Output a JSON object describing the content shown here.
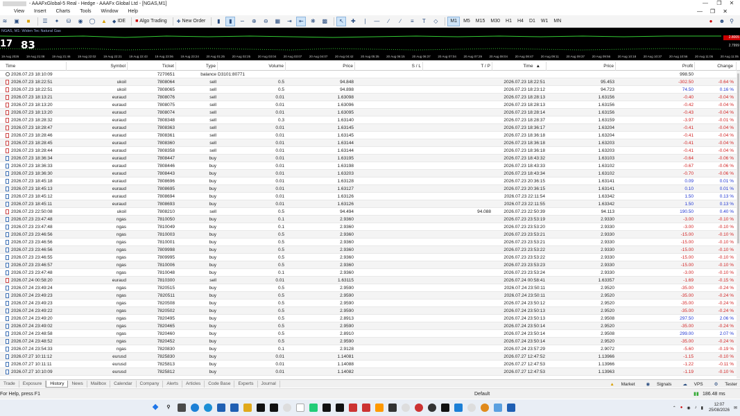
{
  "window": {
    "title": "- AAAFxGlobal-5 Real - Hedge - AAAFx Global Ltd - [NGAS,M1]"
  },
  "menu": [
    "File",
    "View",
    "Insert",
    "Charts",
    "Tools",
    "Window",
    "Help"
  ],
  "toolbar": {
    "ide_label": "IDE",
    "algo_label": "Algo Trading",
    "new_order_label": "New Order",
    "timeframes": [
      "M1",
      "M5",
      "M15",
      "M30",
      "H1",
      "H4",
      "D1",
      "W1",
      "MN"
    ],
    "active_timeframe": "M1"
  },
  "chart": {
    "symbol_line": "NGAS, M1: Widen Tec Natural Gas",
    "big_left": "17",
    "big_mid": "83",
    "price_top": "2.8005",
    "price_mid": "2.7999",
    "time_ticks": [
      "19 Aug 2026",
      "19 Aug 21:08",
      "19 Aug 21:46",
      "19 Aug 22:02",
      "19 Aug 22:21",
      "19 Aug 22:43",
      "19 Aug 23:06",
      "19 Aug 23:24",
      "20 Aug 01:25",
      "20 Aug 02:25",
      "20 Aug 03:04",
      "20 Aug 03:07",
      "20 Aug 04:07",
      "20 Aug 04:42",
      "20 Aug 05:35",
      "20 Aug 06:15",
      "20 Aug 06:37",
      "20 Aug 07:04",
      "20 Aug 07:29",
      "20 Aug 08:04",
      "20 Aug 08:47",
      "20 Aug 09:11",
      "20 Aug 09:37",
      "20 Aug 09:56",
      "20 Aug 10:18",
      "20 Aug 10:37",
      "20 Aug 10:56",
      "20 Aug 11:05",
      "20 Aug 11:05"
    ]
  },
  "table": {
    "headers": {
      "time": "Time",
      "symbol": "Symbol",
      "ticket": "Ticket",
      "type": "Type",
      "volume": "Volume",
      "price": "Price",
      "sl": "S / L",
      "tp": "T / P",
      "time2": "Time",
      "price2": "Price",
      "profit": "Profit",
      "change": "Change"
    },
    "rows": [
      {
        "k": "balance",
        "t": "2026.07.23 18:10:09",
        "s": "",
        "tk": "7270651",
        "ty": "balance",
        "v": "D3101:80771",
        "p": "",
        "sl": "",
        "tp": "",
        "t2": "",
        "p2": "",
        "pr": "998.50",
        "ch": ""
      },
      {
        "k": "sell",
        "t": "2026.07.23 18:22:51",
        "s": "ukoil",
        "tk": "7808064",
        "ty": "sell",
        "v": "0.5",
        "p": "94.848",
        "sl": "",
        "tp": "",
        "t2": "2026.07.23 18:22:51",
        "p2": "95.453",
        "pr": "-302.50",
        "ch": "-0.64 %"
      },
      {
        "k": "sell",
        "t": "2026.07.23 18:22:51",
        "s": "ukoil",
        "tk": "7808065",
        "ty": "sell",
        "v": "0.5",
        "p": "94.898",
        "sl": "",
        "tp": "",
        "t2": "2026.07.23 18:23:12",
        "p2": "94.723",
        "pr": "74.50",
        "ch": "0.16 %"
      },
      {
        "k": "sell",
        "t": "2026.07.23 18:13:21",
        "s": "euraud",
        "tk": "7808076",
        "ty": "sell",
        "v": "0.01",
        "p": "1.63098",
        "sl": "",
        "tp": "",
        "t2": "2026.07.23 18:28:13",
        "p2": "1.63156",
        "pr": "-0.40",
        "ch": "-0.04 %"
      },
      {
        "k": "sell",
        "t": "2026.07.23 18:13:20",
        "s": "euraud",
        "tk": "7808075",
        "ty": "sell",
        "v": "0.01",
        "p": "1.63096",
        "sl": "",
        "tp": "",
        "t2": "2026.07.23 18:28:13",
        "p2": "1.63156",
        "pr": "-0.42",
        "ch": "-0.04 %"
      },
      {
        "k": "sell",
        "t": "2026.07.23 18:13:20",
        "s": "euraud",
        "tk": "7808074",
        "ty": "sell",
        "v": "0.01",
        "p": "1.63095",
        "sl": "",
        "tp": "",
        "t2": "2026.07.23 18:28:14",
        "p2": "1.63156",
        "pr": "-0.43",
        "ch": "-0.04 %"
      },
      {
        "k": "sell",
        "t": "2026.07.23 18:28:32",
        "s": "euraud",
        "tk": "7808348",
        "ty": "sell",
        "v": "0.3",
        "p": "1.63140",
        "sl": "",
        "tp": "",
        "t2": "2026.07.23 18:28:37",
        "p2": "1.63159",
        "pr": "-3.97",
        "ch": "-0.01 %"
      },
      {
        "k": "sell",
        "t": "2026.07.23 18:28:47",
        "s": "euraud",
        "tk": "7808363",
        "ty": "sell",
        "v": "0.01",
        "p": "1.63145",
        "sl": "",
        "tp": "",
        "t2": "2026.07.23 18:36:17",
        "p2": "1.63204",
        "pr": "-0.41",
        "ch": "-0.04 %"
      },
      {
        "k": "sell",
        "t": "2026.07.23 18:28:46",
        "s": "euraud",
        "tk": "7808361",
        "ty": "sell",
        "v": "0.01",
        "p": "1.63145",
        "sl": "",
        "tp": "",
        "t2": "2026.07.23 18:36:18",
        "p2": "1.63204",
        "pr": "-0.41",
        "ch": "-0.04 %"
      },
      {
        "k": "sell",
        "t": "2026.07.23 18:28:45",
        "s": "euraud",
        "tk": "7808360",
        "ty": "sell",
        "v": "0.01",
        "p": "1.63144",
        "sl": "",
        "tp": "",
        "t2": "2026.07.23 18:36:18",
        "p2": "1.63203",
        "pr": "-0.41",
        "ch": "-0.04 %"
      },
      {
        "k": "sell",
        "t": "2026.07.23 18:28:44",
        "s": "euraud",
        "tk": "7808358",
        "ty": "sell",
        "v": "0.01",
        "p": "1.63144",
        "sl": "",
        "tp": "",
        "t2": "2026.07.23 18:36:18",
        "p2": "1.63203",
        "pr": "-0.41",
        "ch": "-0.04 %"
      },
      {
        "k": "buy",
        "t": "2026.07.23 18:36:34",
        "s": "euraud",
        "tk": "7808447",
        "ty": "buy",
        "v": "0.01",
        "p": "1.63195",
        "sl": "",
        "tp": "",
        "t2": "2026.07.23 18:43:32",
        "p2": "1.63103",
        "pr": "-0.64",
        "ch": "-0.06 %"
      },
      {
        "k": "buy",
        "t": "2026.07.23 18:36:33",
        "s": "euraud",
        "tk": "7808446",
        "ty": "buy",
        "v": "0.01",
        "p": "1.63198",
        "sl": "",
        "tp": "",
        "t2": "2026.07.23 18:43:33",
        "p2": "1.63102",
        "pr": "-0.67",
        "ch": "-0.06 %"
      },
      {
        "k": "buy",
        "t": "2026.07.23 18:36:30",
        "s": "euraud",
        "tk": "7808443",
        "ty": "buy",
        "v": "0.01",
        "p": "1.63203",
        "sl": "",
        "tp": "",
        "t2": "2026.07.23 18:43:34",
        "p2": "1.63102",
        "pr": "-0.70",
        "ch": "-0.06 %"
      },
      {
        "k": "buy",
        "t": "2026.07.23 18:45:18",
        "s": "euraud",
        "tk": "7808696",
        "ty": "buy",
        "v": "0.01",
        "p": "1.63128",
        "sl": "",
        "tp": "",
        "t2": "2026.07.23 20:36:15",
        "p2": "1.63141",
        "pr": "0.09",
        "ch": "0.01 %"
      },
      {
        "k": "buy",
        "t": "2026.07.23 18:45:13",
        "s": "euraud",
        "tk": "7808695",
        "ty": "buy",
        "v": "0.01",
        "p": "1.63127",
        "sl": "",
        "tp": "",
        "t2": "2026.07.23 20:36:15",
        "p2": "1.63141",
        "pr": "0.10",
        "ch": "0.01 %"
      },
      {
        "k": "buy",
        "t": "2026.07.23 18:45:12",
        "s": "euraud",
        "tk": "7808694",
        "ty": "buy",
        "v": "0.01",
        "p": "1.63126",
        "sl": "",
        "tp": "",
        "t2": "2026.07.23 22:11:54",
        "p2": "1.63342",
        "pr": "1.50",
        "ch": "0.13 %"
      },
      {
        "k": "buy",
        "t": "2026.07.23 18:45:11",
        "s": "euraud",
        "tk": "7808693",
        "ty": "buy",
        "v": "0.01",
        "p": "1.63126",
        "sl": "",
        "tp": "",
        "t2": "2026.07.23 22:11:55",
        "p2": "1.63342",
        "pr": "1.50",
        "ch": "0.13 %"
      },
      {
        "k": "sell",
        "t": "2026.07.23 22:50:08",
        "s": "ukoil",
        "tk": "7808210",
        "ty": "sell",
        "v": "0.5",
        "p": "94.494",
        "sl": "",
        "tp": "94.088",
        "t2": "2026.07.23 22:50:39",
        "p2": "94.113",
        "pr": "190.50",
        "ch": "0.40 %"
      },
      {
        "k": "buy",
        "t": "2026.07.23 23:47:48",
        "s": "ngas",
        "tk": "7810050",
        "ty": "buy",
        "v": "0.1",
        "p": "2.9360",
        "sl": "",
        "tp": "",
        "t2": "2026.07.23 23:53:19",
        "p2": "2.9330",
        "pr": "-3.00",
        "ch": "-0.10 %"
      },
      {
        "k": "buy",
        "t": "2026.07.23 23:47:48",
        "s": "ngas",
        "tk": "7810049",
        "ty": "buy",
        "v": "0.1",
        "p": "2.9360",
        "sl": "",
        "tp": "",
        "t2": "2026.07.23 23:53:20",
        "p2": "2.9330",
        "pr": "-3.00",
        "ch": "-0.10 %"
      },
      {
        "k": "buy",
        "t": "2026.07.23 23:46:56",
        "s": "ngas",
        "tk": "7810003",
        "ty": "buy",
        "v": "0.5",
        "p": "2.9360",
        "sl": "",
        "tp": "",
        "t2": "2026.07.23 23:53:21",
        "p2": "2.9330",
        "pr": "-15.00",
        "ch": "-0.10 %"
      },
      {
        "k": "buy",
        "t": "2026.07.23 23:46:56",
        "s": "ngas",
        "tk": "7810001",
        "ty": "buy",
        "v": "0.5",
        "p": "2.9360",
        "sl": "",
        "tp": "",
        "t2": "2026.07.23 23:53:21",
        "p2": "2.9330",
        "pr": "-15.00",
        "ch": "-0.10 %"
      },
      {
        "k": "buy",
        "t": "2026.07.23 23:46:56",
        "s": "ngas",
        "tk": "7809998",
        "ty": "buy",
        "v": "0.5",
        "p": "2.9360",
        "sl": "",
        "tp": "",
        "t2": "2026.07.23 23:53:22",
        "p2": "2.9330",
        "pr": "-15.00",
        "ch": "-0.10 %"
      },
      {
        "k": "buy",
        "t": "2026.07.23 23:46:55",
        "s": "ngas",
        "tk": "7809995",
        "ty": "buy",
        "v": "0.5",
        "p": "2.9360",
        "sl": "",
        "tp": "",
        "t2": "2026.07.23 23:53:22",
        "p2": "2.9330",
        "pr": "-15.00",
        "ch": "-0.10 %"
      },
      {
        "k": "buy",
        "t": "2026.07.23 23:46:57",
        "s": "ngas",
        "tk": "7810006",
        "ty": "buy",
        "v": "0.5",
        "p": "2.9360",
        "sl": "",
        "tp": "",
        "t2": "2026.07.23 23:53:23",
        "p2": "2.9330",
        "pr": "-15.00",
        "ch": "-0.10 %"
      },
      {
        "k": "buy",
        "t": "2026.07.23 23:47:48",
        "s": "ngas",
        "tk": "7810048",
        "ty": "buy",
        "v": "0.1",
        "p": "2.9360",
        "sl": "",
        "tp": "",
        "t2": "2026.07.23 23:53:24",
        "p2": "2.9330",
        "pr": "-3.00",
        "ch": "-0.10 %"
      },
      {
        "k": "sell",
        "t": "2026.07.24 00:58:20",
        "s": "euraud",
        "tk": "7810300",
        "ty": "sell",
        "v": "0.01",
        "p": "1.63115",
        "sl": "",
        "tp": "",
        "t2": "2026.07.24 00:58:41",
        "p2": "1.63357",
        "pr": "-1.69",
        "ch": "-0.15 %"
      },
      {
        "k": "buy",
        "t": "2026.07.24 23:49:24",
        "s": "ngas",
        "tk": "7820515",
        "ty": "buy",
        "v": "0.5",
        "p": "2.9590",
        "sl": "",
        "tp": "",
        "t2": "2026.07.24 23:50:11",
        "p2": "2.9520",
        "pr": "-35.00",
        "ch": "-0.24 %"
      },
      {
        "k": "buy",
        "t": "2026.07.24 23:49:23",
        "s": "ngas",
        "tk": "7820511",
        "ty": "buy",
        "v": "0.5",
        "p": "2.9590",
        "sl": "",
        "tp": "",
        "t2": "2026.07.24 23:50:11",
        "p2": "2.9520",
        "pr": "-35.00",
        "ch": "-0.24 %"
      },
      {
        "k": "buy",
        "t": "2026.07.24 23:49:23",
        "s": "ngas",
        "tk": "7820508",
        "ty": "buy",
        "v": "0.5",
        "p": "2.9590",
        "sl": "",
        "tp": "",
        "t2": "2026.07.24 23:50:12",
        "p2": "2.9520",
        "pr": "-35.00",
        "ch": "-0.24 %"
      },
      {
        "k": "buy",
        "t": "2026.07.24 23:49:22",
        "s": "ngas",
        "tk": "7820502",
        "ty": "buy",
        "v": "0.5",
        "p": "2.9590",
        "sl": "",
        "tp": "",
        "t2": "2026.07.24 23:50:13",
        "p2": "2.9520",
        "pr": "-35.00",
        "ch": "-0.24 %"
      },
      {
        "k": "buy",
        "t": "2026.07.24 23:49:20",
        "s": "ngas",
        "tk": "7820495",
        "ty": "buy",
        "v": "0.5",
        "p": "2.8913",
        "sl": "",
        "tp": "",
        "t2": "2026.07.24 23:50:13",
        "p2": "2.9508",
        "pr": "297.50",
        "ch": "2.06 %"
      },
      {
        "k": "buy",
        "t": "2026.07.24 23:49:02",
        "s": "ngas",
        "tk": "7820465",
        "ty": "buy",
        "v": "0.5",
        "p": "2.9590",
        "sl": "",
        "tp": "",
        "t2": "2026.07.24 23:50:14",
        "p2": "2.9520",
        "pr": "-35.00",
        "ch": "-0.24 %"
      },
      {
        "k": "buy",
        "t": "2026.07.24 23:48:58",
        "s": "ngas",
        "tk": "7820460",
        "ty": "buy",
        "v": "0.5",
        "p": "2.8910",
        "sl": "",
        "tp": "",
        "t2": "2026.07.24 23:50:14",
        "p2": "2.9508",
        "pr": "299.00",
        "ch": "2.07 %"
      },
      {
        "k": "buy",
        "t": "2026.07.24 23:48:52",
        "s": "ngas",
        "tk": "7820452",
        "ty": "buy",
        "v": "0.5",
        "p": "2.9590",
        "sl": "",
        "tp": "",
        "t2": "2026.07.24 23:50:14",
        "p2": "2.9520",
        "pr": "-35.00",
        "ch": "-0.24 %"
      },
      {
        "k": "buy",
        "t": "2026.07.24 23:54:33",
        "s": "ngas",
        "tk": "7820830",
        "ty": "buy",
        "v": "0.1",
        "p": "2.9128",
        "sl": "",
        "tp": "",
        "t2": "2026.07.24 23:57:29",
        "p2": "2.9072",
        "pr": "-5.60",
        "ch": "-0.19 %"
      },
      {
        "k": "buy",
        "t": "2026.07.27 10:11:12",
        "s": "eurusd",
        "tk": "7825830",
        "ty": "buy",
        "v": "0.01",
        "p": "1.14081",
        "sl": "",
        "tp": "",
        "t2": "2026.07.27 12:47:52",
        "p2": "1.13966",
        "pr": "-1.15",
        "ch": "-0.10 %"
      },
      {
        "k": "buy",
        "t": "2026.07.27 10:11:11",
        "s": "eurusd",
        "tk": "7825813",
        "ty": "buy",
        "v": "0.01",
        "p": "1.14088",
        "sl": "",
        "tp": "",
        "t2": "2026.07.27 12:47:53",
        "p2": "1.13966",
        "pr": "-1.22",
        "ch": "-0.11 %"
      },
      {
        "k": "buy",
        "t": "2026.07.27 10:10:09",
        "s": "eurusd",
        "tk": "7825812",
        "ty": "buy",
        "v": "0.01",
        "p": "1.14082",
        "sl": "",
        "tp": "",
        "t2": "2026.07.27 12:47:53",
        "p2": "1.13963",
        "pr": "-1.19",
        "ch": "-0.10 %"
      }
    ]
  },
  "tabs": [
    "Trade",
    "Exposure",
    "History",
    "News",
    "Mailbox",
    "Calendar",
    "Company",
    "Alerts",
    "Articles",
    "Code Base",
    "Experts",
    "Journal"
  ],
  "active_tab": "History",
  "right_tabs": [
    "Market",
    "Signals",
    "VPS",
    "Tester"
  ],
  "status": {
    "help": "For Help, press F1",
    "profile": "Default",
    "traffic": "186.48 ms"
  },
  "clock": {
    "time": "12:07",
    "date": "25/08/2026"
  },
  "colors": {
    "negative": "#d21f1f",
    "positive": "#1f35d2"
  }
}
